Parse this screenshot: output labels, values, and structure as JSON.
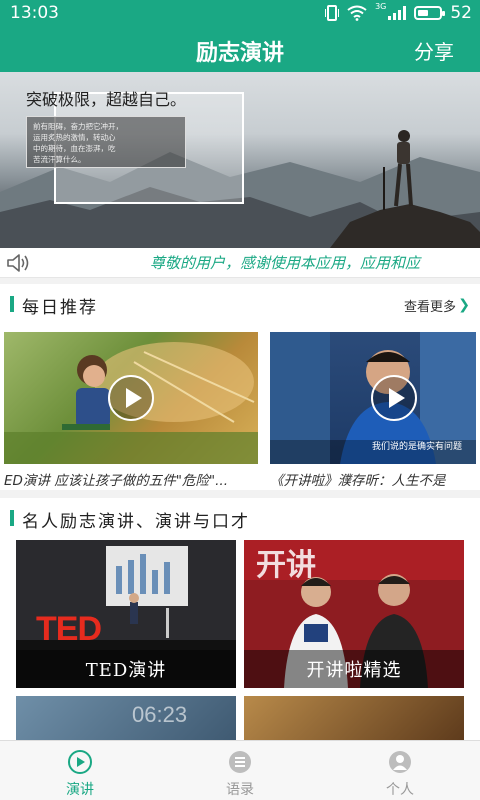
{
  "status": {
    "time": "13:03",
    "network": "3G",
    "battery": "52",
    "battery_level": 0.52
  },
  "header": {
    "title": "励志演讲",
    "share_label": "分享"
  },
  "banner": {
    "headline": "突破极限，超越自己。",
    "body_lines": [
      "前有阻碍，奋力把它冲开，",
      "运用炙热的激情，转动心",
      "中的期待，血在澎湃，吃",
      "苦流汗算什么。"
    ]
  },
  "notice": {
    "text": "尊敬的用户，感谢使用本应用，应用和应"
  },
  "daily": {
    "title": "每日推荐",
    "more_label": "查看更多",
    "items": [
      {
        "caption": "ED演讲 应该让孩子做的五件\"危险\"..."
      },
      {
        "caption": "《开讲啦》濮存昕：人生不是"
      }
    ],
    "subtitle_text": "我们说的是确实有问题"
  },
  "famous": {
    "title": "名人励志演讲、演讲与口才",
    "tiles": [
      {
        "label": "TED演讲",
        "logo": "TED"
      },
      {
        "label": "开讲啦精选",
        "logo": "开讲"
      }
    ],
    "clock_text": "06:23"
  },
  "nav": {
    "items": [
      {
        "label": "演讲",
        "icon": "play-circle-icon",
        "active": true
      },
      {
        "label": "语录",
        "icon": "list-icon",
        "active": false
      },
      {
        "label": "个人",
        "icon": "person-icon",
        "active": false
      }
    ]
  },
  "colors": {
    "accent": "#1aa884",
    "inactive": "#999999"
  }
}
